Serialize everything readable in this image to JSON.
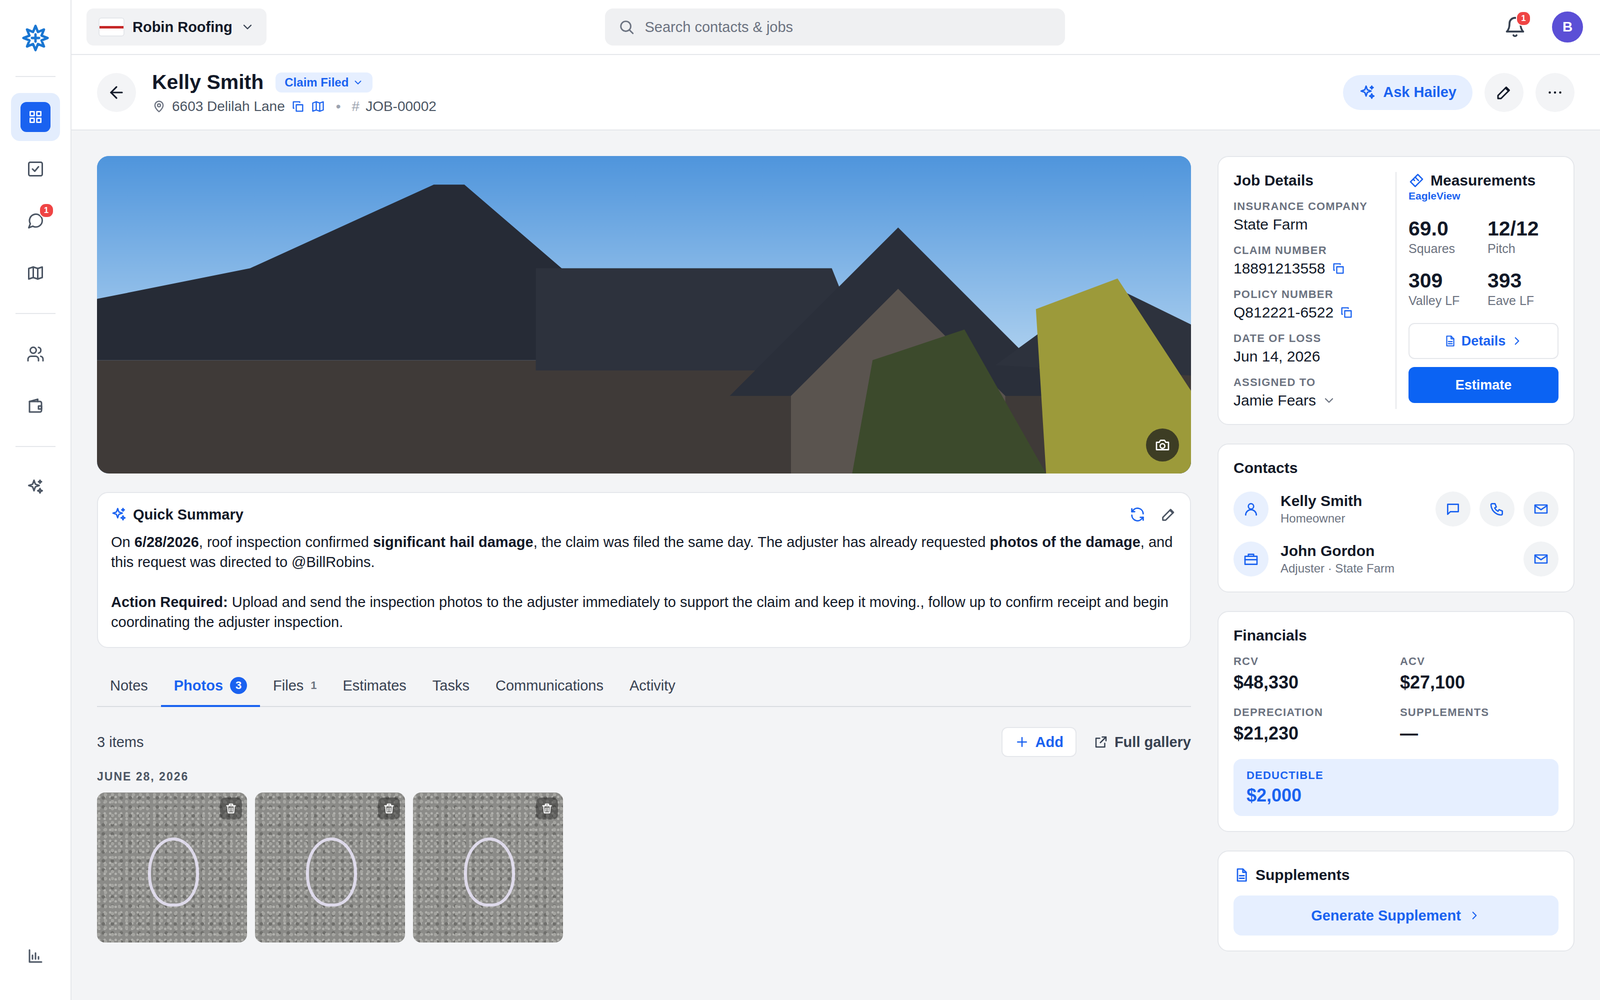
{
  "company": {
    "name": "Robin Roofing"
  },
  "search": {
    "placeholder": "Search contacts & jobs"
  },
  "notifications": {
    "count": "1"
  },
  "user": {
    "initial": "B"
  },
  "sidebar": {
    "groups": [
      [
        {
          "selected": true,
          "badge": ""
        },
        {
          "selected": false,
          "badge": ""
        },
        {
          "selected": false,
          "badge": "1"
        },
        {
          "selected": false,
          "badge": ""
        }
      ],
      [
        {
          "selected": false,
          "badge": ""
        },
        {
          "selected": false,
          "badge": ""
        }
      ],
      [
        {
          "selected": false,
          "badge": ""
        }
      ]
    ],
    "bottom": [
      {
        "selected": false,
        "badge": ""
      }
    ]
  },
  "header": {
    "title": "Kelly Smith",
    "status": "Claim Filed",
    "address": "6603 Delilah Lane",
    "separator": "•",
    "job_mark": "#",
    "job_number": "JOB-00002",
    "ask_button": "Ask Hailey"
  },
  "summary": {
    "title": "Quick Summary",
    "paragraphs": [
      [
        {
          "text": "On ",
          "bold": false
        },
        {
          "text": "6/28/2026",
          "bold": true
        },
        {
          "text": ", roof inspection confirmed ",
          "bold": false
        },
        {
          "text": "significant hail damage",
          "bold": true
        },
        {
          "text": ", the claim was filed the same day. The adjuster has already requested ",
          "bold": false
        },
        {
          "text": "photos of the damage",
          "bold": true
        },
        {
          "text": ", and this request was directed to @BillRobins.",
          "bold": false
        }
      ],
      [
        {
          "text": "Action Required:",
          "bold": true
        },
        {
          "text": " Upload and send the inspection photos to the adjuster immediately to support the claim and keep it moving., follow up to confirm receipt and begin coordinating the adjuster inspection.",
          "bold": false
        }
      ]
    ]
  },
  "tabs": [
    {
      "label": "Notes",
      "count": "",
      "selected": false
    },
    {
      "label": "Photos",
      "count": "3",
      "selected": true
    },
    {
      "label": "Files",
      "count": "1",
      "selected": false
    },
    {
      "label": "Estimates",
      "count": "",
      "selected": false
    },
    {
      "label": "Tasks",
      "count": "",
      "selected": false
    },
    {
      "label": "Communications",
      "count": "",
      "selected": false
    },
    {
      "label": "Activity",
      "count": "",
      "selected": false
    }
  ],
  "gallery": {
    "count_label": "3 items",
    "add_button": "Add",
    "gallery_button": "Full gallery",
    "groups": [
      {
        "date": "JUNE 28, 2026",
        "photos": [
          {
            "deletable": true
          },
          {
            "deletable": true
          },
          {
            "deletable": true
          }
        ]
      }
    ]
  },
  "job_details": {
    "title": "Job Details",
    "fields": [
      {
        "label": "INSURANCE COMPANY",
        "value": "State Farm",
        "copy": false,
        "dropdown": false
      },
      {
        "label": "CLAIM NUMBER",
        "value": "18891213558",
        "copy": true,
        "dropdown": false
      },
      {
        "label": "POLICY NUMBER",
        "value": "Q812221-6522",
        "copy": true,
        "dropdown": false
      },
      {
        "label": "DATE OF LOSS",
        "value": "Jun 14, 2026",
        "copy": false,
        "dropdown": false
      },
      {
        "label": "ASSIGNED TO",
        "value": "Jamie Fears",
        "copy": false,
        "dropdown": true
      }
    ]
  },
  "measurements": {
    "title": "Measurements",
    "source": "EagleView",
    "stats": [
      {
        "value": "69.0",
        "label": "Squares"
      },
      {
        "value": "12/12",
        "label": "Pitch"
      },
      {
        "value": "309",
        "label": "Valley LF"
      },
      {
        "value": "393",
        "label": "Eave LF"
      }
    ],
    "details_button": "Details",
    "estimate_button": "Estimate"
  },
  "contacts": {
    "title": "Contacts",
    "items": [
      {
        "name": "Kelly Smith",
        "role": "Homeowner",
        "kind": "homeowner"
      },
      {
        "name": "John Gordon",
        "role": "Adjuster · State Farm",
        "kind": "adjuster"
      }
    ]
  },
  "financials": {
    "title": "Financials",
    "items": [
      {
        "label": "RCV",
        "value": "$48,330"
      },
      {
        "label": "ACV",
        "value": "$27,100"
      },
      {
        "label": "DEPRECIATION",
        "value": "$21,230"
      },
      {
        "label": "SUPPLEMENTS",
        "value": "—"
      }
    ],
    "deductible": {
      "label": "DEDUCTIBLE",
      "value": "$2,000"
    }
  },
  "supplements": {
    "title": "Supplements",
    "action": "Generate Supplement"
  }
}
